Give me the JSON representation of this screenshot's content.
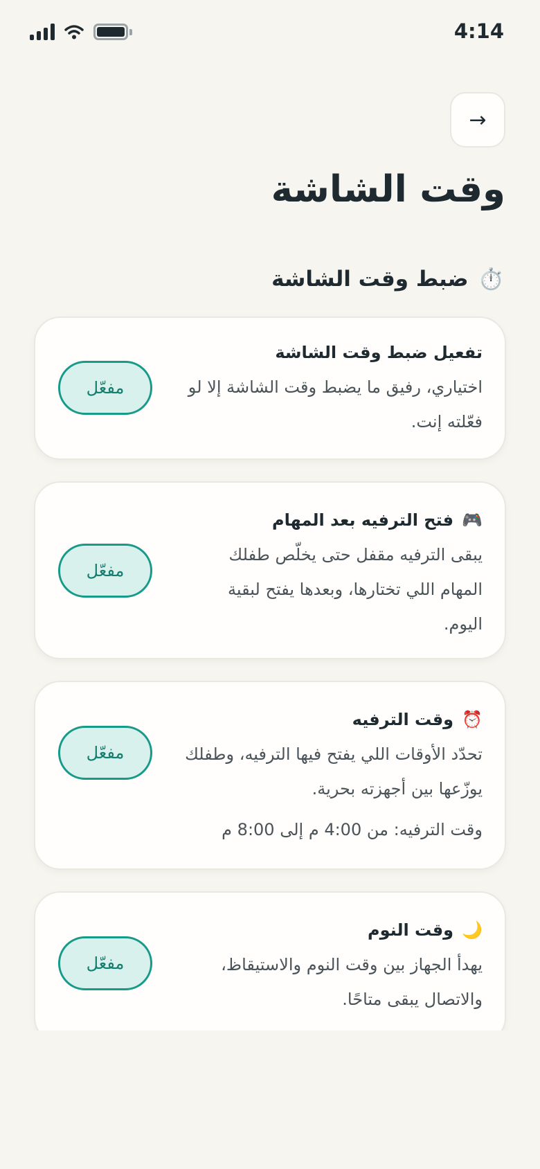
{
  "status_bar": {
    "time": "4:14"
  },
  "header": {
    "back_label": "→",
    "title": "وقت الشاشة"
  },
  "section": {
    "icon": "stopwatch-icon",
    "emoji": "⏱️",
    "title": "ضبط وقت الشاشة"
  },
  "cards": [
    {
      "title": "تفعيل ضبط وقت الشاشة",
      "description": "اختياري، رفيق ما يضبط وقت الشاشة إلا لو فعّلته إنت.",
      "toggle_label": "مفعّل"
    },
    {
      "icon": "game-controller-icon",
      "emoji": "🎮",
      "title": "فتح الترفيه بعد المهام",
      "description": "يبقى الترفيه مقفل حتى يخلّص طفلك المهام اللي تختارها، وبعدها يفتح لبقية اليوم.",
      "toggle_label": "مفعّل"
    },
    {
      "icon": "alarm-clock-icon",
      "emoji": "⏰",
      "title": "وقت الترفيه",
      "description": "تحدّد الأوقات اللي يفتح فيها الترفيه، وطفلك يوزّعها بين أجهزته بحرية.",
      "extra": "وقت الترفيه: من 4:00 م إلى 8:00 م",
      "toggle_label": "مفعّل"
    },
    {
      "icon": "crescent-moon-icon",
      "emoji": "🌙",
      "title": "وقت النوم",
      "description": "يهدأ الجهاز بين وقت النوم والاستيقاظ، والاتصال يبقى متاحًا.",
      "toggle_label": "مفعّل"
    }
  ],
  "colors": {
    "background": "#f7f5f0",
    "accent": "#179a89",
    "accent_fill": "#d8f1ec"
  }
}
